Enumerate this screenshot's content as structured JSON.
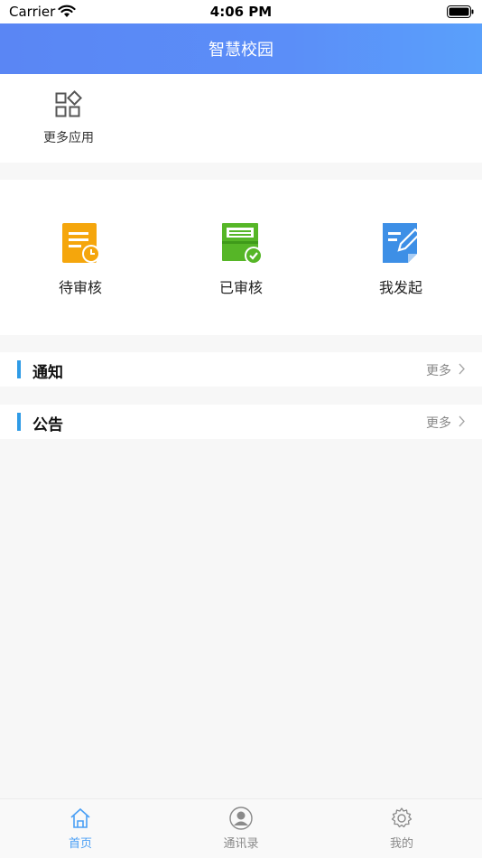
{
  "status_bar": {
    "carrier": "Carrier",
    "time": "4:06 PM"
  },
  "header": {
    "title": "智慧校园"
  },
  "apps": {
    "more_label": "更多应用"
  },
  "approvals": {
    "items": [
      {
        "label": "待审核",
        "icon": "pending-review-icon",
        "color": "#f5a60c"
      },
      {
        "label": "已审核",
        "icon": "reviewed-icon",
        "color": "#56b627"
      },
      {
        "label": "我发起",
        "icon": "my-initiated-icon",
        "color": "#3d8fe6"
      }
    ]
  },
  "sections": {
    "notice": {
      "title": "通知",
      "more": "更多"
    },
    "announcement": {
      "title": "公告",
      "more": "更多"
    }
  },
  "tabbar": {
    "items": [
      {
        "label": "首页",
        "icon": "home-icon",
        "active": true
      },
      {
        "label": "通讯录",
        "icon": "contacts-icon",
        "active": false
      },
      {
        "label": "我的",
        "icon": "settings-icon",
        "active": false
      }
    ]
  },
  "colors": {
    "header_start": "#5a86f4",
    "header_end": "#5aa0fb",
    "accent_bar": "#2f9be6",
    "tab_active": "#4a9ff5"
  }
}
